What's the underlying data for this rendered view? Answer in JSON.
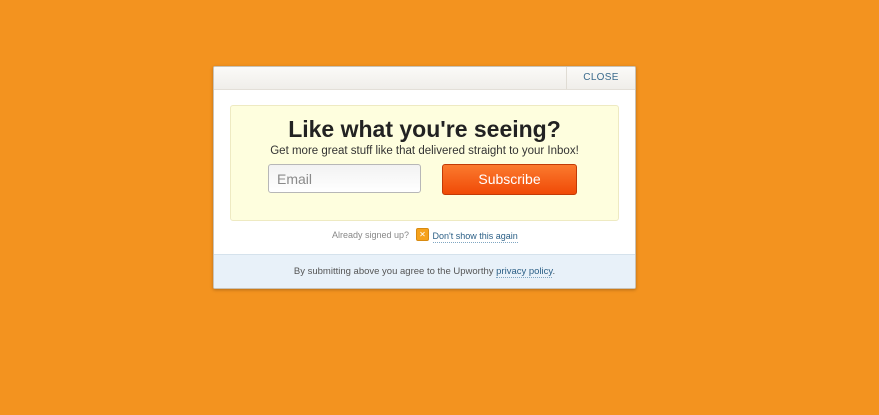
{
  "modal": {
    "close_label": "CLOSE",
    "headline": "Like what you're seeing?",
    "subline": "Get more great stuff like that delivered straight to your Inbox!",
    "email_placeholder": "Email",
    "subscribe_label": "Subscribe",
    "already_label": "Already signed up?",
    "dont_show_label": "Don't show this again",
    "dont_show_icon": "close-x-icon",
    "footer_text": "By submitting above you agree to the Upworthy ",
    "policy_link": "privacy policy",
    "footer_suffix": "."
  },
  "colors": {
    "background": "#f3931f",
    "promo_bg": "#fefede",
    "subscribe_bg": "#f04a07",
    "footer_bg": "#e8f1f9",
    "link": "#2b5f86"
  }
}
